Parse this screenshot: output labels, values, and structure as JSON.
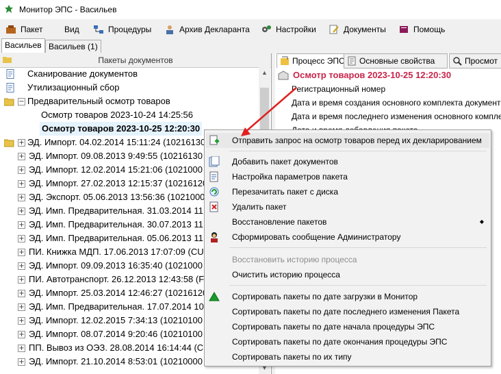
{
  "window": {
    "title": "Монитор ЭПС - Васильев"
  },
  "menu": [
    "Пакет",
    "Вид",
    "Процедуры",
    "Архив Декларанта",
    "Настройки",
    "Документы",
    "Помощь"
  ],
  "session_tabs": [
    "Васильев",
    "Васильев (1)"
  ],
  "left_panel": {
    "header": "Пакеты документов",
    "rows": [
      "Сканирование документов",
      "Утилизационный сбор",
      "Предварительный осмотр товаров",
      "Осмотр товаров 2023-10-24 14:25:56",
      "Осмотр товаров 2023-10-25 12:20:30",
      "ЭД. Импорт. 04.02.2014 15:11:24 (10216130",
      "ЭД. Импорт. 09.08.2013 9:49:55 (10216130",
      "ЭД. Импорт. 12.02.2014 15:21:06 (1021000",
      "ЭД. Импорт. 27.02.2013 12:15:37 (10216120",
      "ЭД. Экспорт. 05.06.2013 13:56:36 (1021000",
      "ЭД. Имп. Предварительная. 31.03.2014 11",
      "ЭД. Имп. Предварительная. 30.07.2013 11",
      "ЭД. Имп. Предварительная. 05.06.2013 11",
      "ПИ. Книжка МДП. 17.06.2013 17:07:09 (CU",
      "ЭД. Импорт. 09.09.2013 16:35:40 (1021000",
      "ПИ. Автотранспорт. 26.12.2013 12:43:58 (F",
      "ЭД. Импорт. 25.03.2014 12:46:27 (10216120",
      "ЭД. Имп. Предварительная. 17.07.2014 10",
      "ЭД. Импорт. 12.02.2015 7:34:13 (10210100",
      "ЭД. Импорт. 08.07.2014 9:20:46 (10210100",
      "ПП. Вывоз из ОЭЗ. 28.08.2014 16:14:44 (CU",
      "ЭД. Импорт. 21.10.2014 8:53:01 (10210000"
    ]
  },
  "right_panel": {
    "tabs": [
      "Процесс ЭПС",
      "Основные свойства",
      "Просмот"
    ],
    "title": "Осмотр товаров 2023-10-25 12:20:30",
    "rows": [
      "Регистрационный номер",
      "Дата и время создания основного комплекта документов",
      "Дата и время последнего изменения основного комплекта",
      "Дата и время добавления пакета"
    ]
  },
  "context_menu": {
    "items": [
      "Отправить запрос на осмотр товаров перед их декларированием",
      "Добавить пакет документов",
      "Настройка параметров пакета",
      "Перезачитать пакет с диска",
      "Удалить пакет",
      "Восстановление пакетов",
      "Сформировать сообщение Администратору",
      "Восстановить историю процесса",
      "Очистить историю процесса",
      "Сортировать пакеты по дате загрузки в Монитор",
      "Сортировать пакеты по дате последнего изменения Пакета",
      "Сортировать пакеты по дате начала процедуры ЭПС",
      "Сортировать пакеты по дате окончания процедуры ЭПС",
      "Сортировать пакеты по их типу"
    ]
  },
  "colors": {
    "title_highlight": "#c8254b",
    "arrow": "#e02020",
    "selection": "#e5f3ff"
  }
}
